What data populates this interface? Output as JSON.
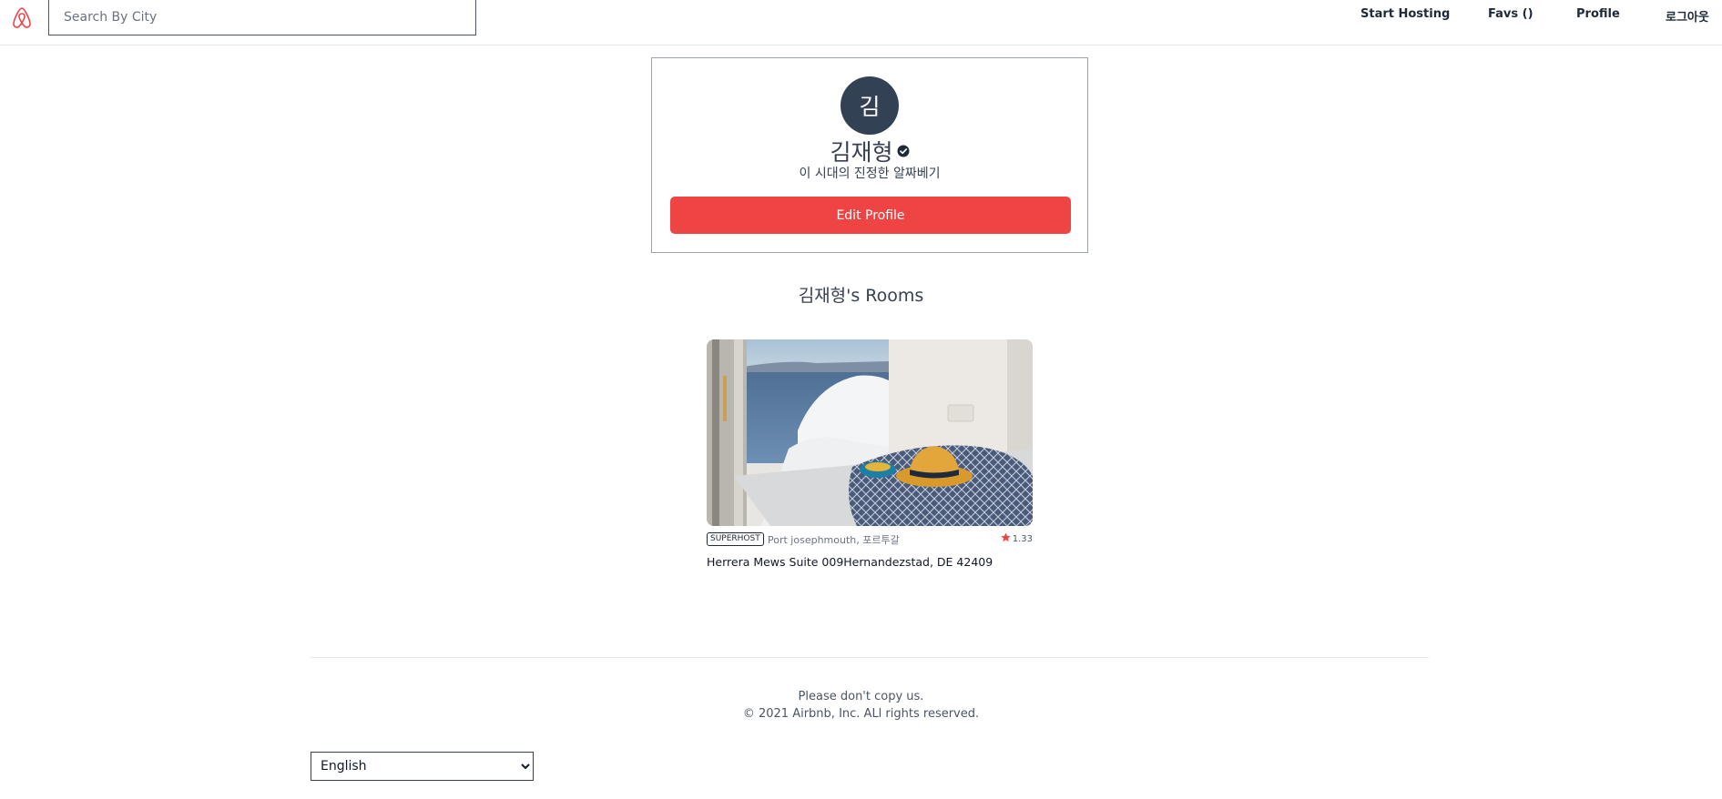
{
  "header": {
    "logo_icon": "airbnb-logo-icon",
    "search_placeholder": "Search By City",
    "links": [
      "Start Hosting",
      "Favs ()",
      "Profile",
      "로그아웃"
    ]
  },
  "profile": {
    "avatar_letter": "김",
    "name": "김재형",
    "verified_icon": "verified-check-icon",
    "bio": "이 시대의 진정한 알짜베기",
    "edit_label": "Edit Profile"
  },
  "rooms": {
    "title": "김재형's Rooms",
    "items": [
      {
        "badge": "SUPERHOST",
        "location": "Port josephmouth, 포르투갈",
        "rating": "1.33",
        "address": "Herrera Mews Suite 009Hernandezstad, DE 42409"
      }
    ]
  },
  "footer": {
    "line1": "Please don't copy us.",
    "line2": "© 2021 Airbnb, Inc. ALl rights reserved.",
    "language": "English"
  },
  "colors": {
    "brand": "#ef4444",
    "avatar_bg": "#334155"
  }
}
